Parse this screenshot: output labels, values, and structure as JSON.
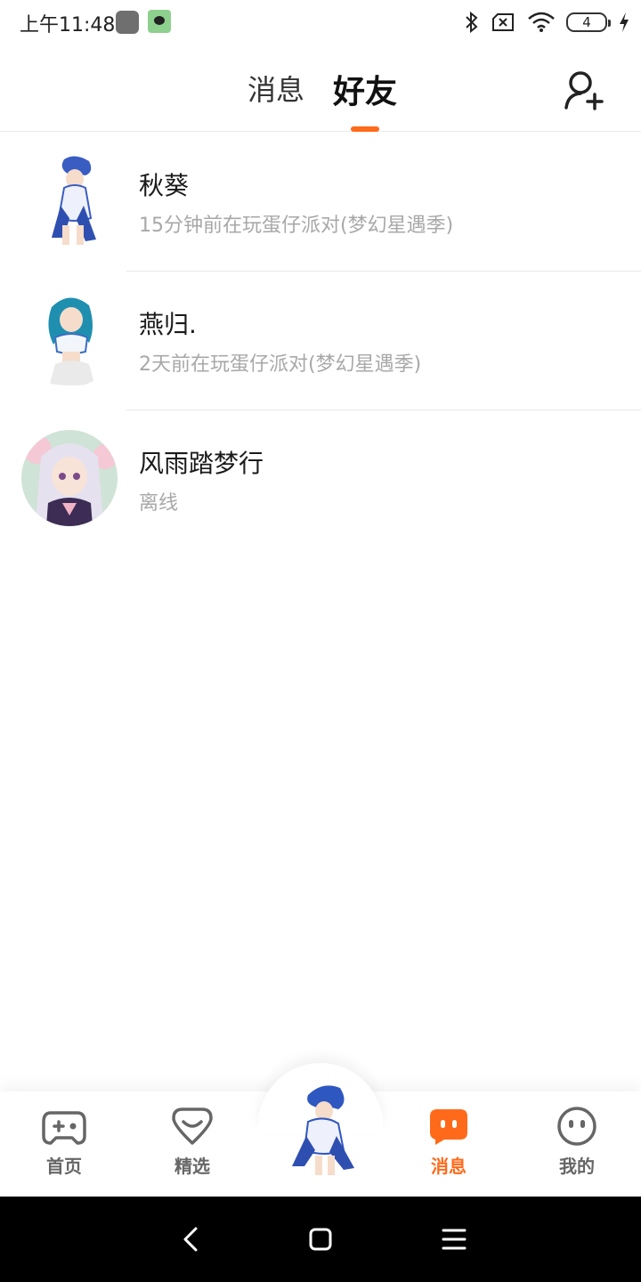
{
  "status_bar": {
    "time": "上午11:48",
    "battery_level": "4",
    "icons": [
      "bluetooth-icon",
      "sim-off-icon",
      "wifi-icon",
      "battery-icon",
      "charging-icon"
    ]
  },
  "header": {
    "tabs": [
      {
        "label": "消息",
        "active": false
      },
      {
        "label": "好友",
        "active": true
      }
    ],
    "accent_color": "#ff6a1a",
    "add_friend_icon": "add-user-icon"
  },
  "friends": [
    {
      "name": "秋葵",
      "status": "15分钟前在玩蛋仔派对(梦幻星遇季)"
    },
    {
      "name": "燕归.",
      "status": "2天前在玩蛋仔派对(梦幻星遇季)"
    },
    {
      "name": "风雨踏梦行",
      "status": "离线"
    }
  ],
  "bottom_nav": {
    "items": [
      {
        "label": "首页",
        "icon": "gamepad-icon",
        "active": false
      },
      {
        "label": "精选",
        "icon": "heart-badge-icon",
        "active": false
      },
      {
        "label": "消息",
        "icon": "chat-icon",
        "active": true
      },
      {
        "label": "我的",
        "icon": "face-icon",
        "active": false
      }
    ],
    "center_icon": "character-avatar-icon"
  },
  "system_nav": [
    "back-icon",
    "home-icon",
    "menu-icon"
  ]
}
